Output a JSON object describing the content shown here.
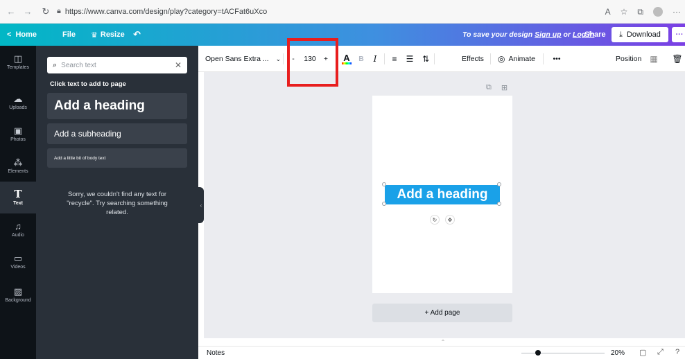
{
  "browser": {
    "url": "https://www.canva.com/design/play?category=tACFat6uXco",
    "back_icon": "back-arrow-icon",
    "forward_icon": "forward-arrow-icon",
    "reload_icon": "reload-icon",
    "more_label": "···"
  },
  "topbar": {
    "home_label": "Home",
    "file_label": "File",
    "resize_label": "Resize",
    "save_prefix": "To save your design",
    "signup_label": "Sign up",
    "or_label": "or",
    "login_label": "Log in",
    "share_label": "Share",
    "download_label": "Download",
    "more_label": "···",
    "gradient_colors": [
      "#01b7c5",
      "#3f8fe0",
      "#7b3fe4"
    ]
  },
  "rail": {
    "items": [
      {
        "label": "Templates",
        "icon": "templates-icon",
        "active": false
      },
      {
        "label": "Uploads",
        "icon": "uploads-icon",
        "active": false
      },
      {
        "label": "Photos",
        "icon": "photos-icon",
        "active": false
      },
      {
        "label": "Elements",
        "icon": "elements-icon",
        "active": false
      },
      {
        "label": "Text",
        "icon": "text-icon",
        "active": true
      },
      {
        "label": "Audio",
        "icon": "audio-icon",
        "active": false
      },
      {
        "label": "Videos",
        "icon": "videos-icon",
        "active": false
      },
      {
        "label": "Background",
        "icon": "background-icon",
        "active": false
      }
    ]
  },
  "panel": {
    "search_placeholder": "Search text",
    "click_hint": "Click text to add to page",
    "heading_option": "Add a heading",
    "subheading_option": "Add a subheading",
    "body_option": "Add a little bit of body text",
    "sorry_message": "Sorry, we couldn't find any text for \"recycle\". Try searching something related."
  },
  "toolbar": {
    "font_name": "Open Sans Extra ...",
    "font_size": "130",
    "minus_label": "-",
    "plus_label": "+",
    "effects_label": "Effects",
    "animate_label": "Animate",
    "more_label": "•••",
    "position_label": "Position"
  },
  "canvas": {
    "heading_text": "Add a heading",
    "add_page_label": "+ Add page",
    "selection_color": "#1aa1e8"
  },
  "bottombar": {
    "notes_label": "Notes",
    "zoom_value": "20%",
    "zoom_fraction": 0.2
  },
  "annotation": {
    "highlight_color": "#e81e1e"
  }
}
